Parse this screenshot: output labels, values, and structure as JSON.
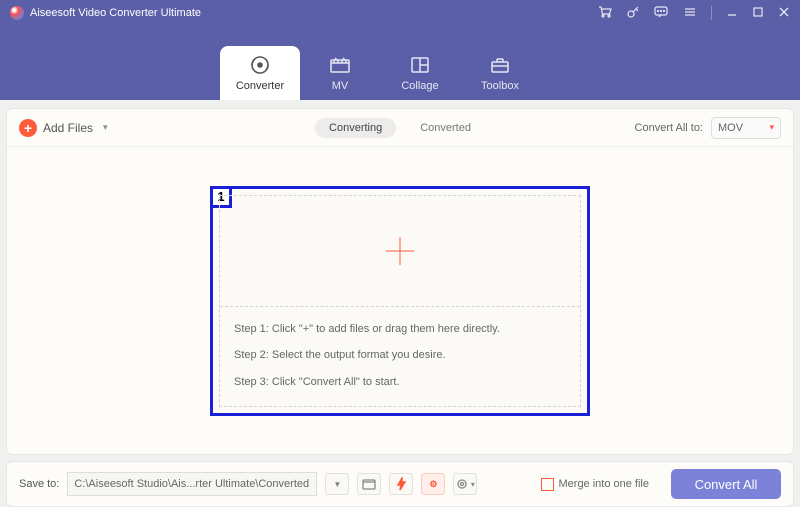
{
  "app": {
    "title": "Aiseesoft Video Converter Ultimate"
  },
  "nav": {
    "tabs": [
      {
        "label": "Converter"
      },
      {
        "label": "MV"
      },
      {
        "label": "Collage"
      },
      {
        "label": "Toolbox"
      }
    ]
  },
  "toolbar": {
    "add_files": "Add Files",
    "subtabs": {
      "converting": "Converting",
      "converted": "Converted"
    },
    "convert_all_to": "Convert All to:",
    "format": "MOV"
  },
  "dropzone": {
    "badge": "1",
    "step1": "Step 1: Click \"+\" to add files or drag them here directly.",
    "step2": "Step 2: Select the output format you desire.",
    "step3": "Step 3: Click \"Convert All\" to start."
  },
  "footer": {
    "save_to": "Save to:",
    "path": "C:\\Aiseesoft Studio\\Ais...rter Ultimate\\Converted",
    "merge": "Merge into one file",
    "convert_all": "Convert All"
  }
}
